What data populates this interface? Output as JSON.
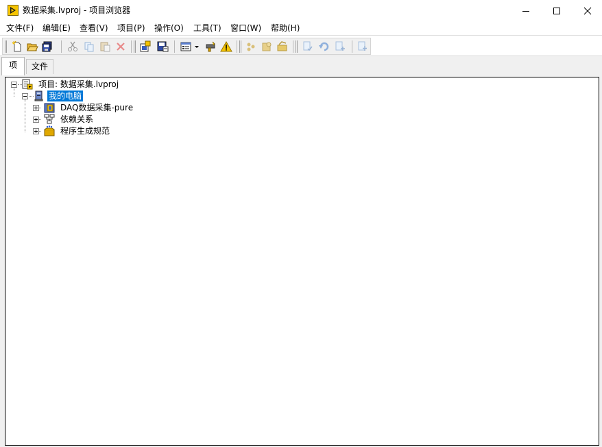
{
  "window": {
    "title": "数据采集.lvproj - 项目浏览器",
    "controls": {
      "minimize": "—",
      "maximize": "☐",
      "close": "✕"
    }
  },
  "menubar": {
    "items": [
      {
        "label": "文件(F)"
      },
      {
        "label": "编辑(E)"
      },
      {
        "label": "查看(V)"
      },
      {
        "label": "项目(P)"
      },
      {
        "label": "操作(O)"
      },
      {
        "label": "工具(T)"
      },
      {
        "label": "窗口(W)"
      },
      {
        "label": "帮助(H)"
      }
    ]
  },
  "toolbar": {
    "icons": [
      "new-icon",
      "open-icon",
      "save-all-icon",
      "cut-icon",
      "copy-icon",
      "paste-icon",
      "delete-icon",
      "project-build-icon",
      "save-icon",
      "view-options-icon",
      "dropdown-arrow-icon",
      "tools-icon",
      "warning-icon",
      "deploy-icon",
      "build-icon",
      "build-all-icon",
      "check-icon",
      "undo-icon",
      "redo-icon",
      "add-item-icon"
    ]
  },
  "tabs": {
    "items": [
      {
        "label": "项",
        "active": true
      },
      {
        "label": "文件",
        "active": false
      }
    ]
  },
  "tree": {
    "root": {
      "label": "项目: 数据采集.lvproj",
      "icon": "project-icon"
    },
    "computer": {
      "label": "我的电脑",
      "icon": "computer-icon",
      "selected": true
    },
    "children": [
      {
        "label": "DAQ数据采集-pure",
        "icon": "folder-library-icon"
      },
      {
        "label": "依赖关系",
        "icon": "dependencies-icon"
      },
      {
        "label": "程序生成规范",
        "icon": "build-specs-icon"
      }
    ]
  },
  "colors": {
    "selection": "#0078d7",
    "labview_yellow": "#f5c400",
    "toolbar_bg": "#f0f0f0"
  }
}
